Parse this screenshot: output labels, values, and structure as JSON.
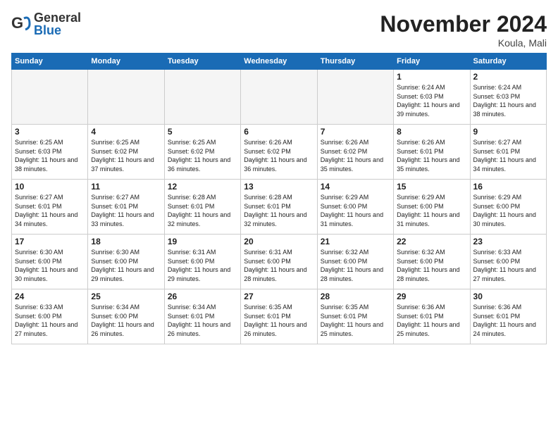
{
  "header": {
    "logo_general": "General",
    "logo_blue": "Blue",
    "month_title": "November 2024",
    "location": "Koula, Mali"
  },
  "days_of_week": [
    "Sunday",
    "Monday",
    "Tuesday",
    "Wednesday",
    "Thursday",
    "Friday",
    "Saturday"
  ],
  "weeks": [
    [
      {
        "day": "",
        "info": ""
      },
      {
        "day": "",
        "info": ""
      },
      {
        "day": "",
        "info": ""
      },
      {
        "day": "",
        "info": ""
      },
      {
        "day": "",
        "info": ""
      },
      {
        "day": "1",
        "info": "Sunrise: 6:24 AM\nSunset: 6:03 PM\nDaylight: 11 hours and 39 minutes."
      },
      {
        "day": "2",
        "info": "Sunrise: 6:24 AM\nSunset: 6:03 PM\nDaylight: 11 hours and 38 minutes."
      }
    ],
    [
      {
        "day": "3",
        "info": "Sunrise: 6:25 AM\nSunset: 6:03 PM\nDaylight: 11 hours and 38 minutes."
      },
      {
        "day": "4",
        "info": "Sunrise: 6:25 AM\nSunset: 6:02 PM\nDaylight: 11 hours and 37 minutes."
      },
      {
        "day": "5",
        "info": "Sunrise: 6:25 AM\nSunset: 6:02 PM\nDaylight: 11 hours and 36 minutes."
      },
      {
        "day": "6",
        "info": "Sunrise: 6:26 AM\nSunset: 6:02 PM\nDaylight: 11 hours and 36 minutes."
      },
      {
        "day": "7",
        "info": "Sunrise: 6:26 AM\nSunset: 6:02 PM\nDaylight: 11 hours and 35 minutes."
      },
      {
        "day": "8",
        "info": "Sunrise: 6:26 AM\nSunset: 6:01 PM\nDaylight: 11 hours and 35 minutes."
      },
      {
        "day": "9",
        "info": "Sunrise: 6:27 AM\nSunset: 6:01 PM\nDaylight: 11 hours and 34 minutes."
      }
    ],
    [
      {
        "day": "10",
        "info": "Sunrise: 6:27 AM\nSunset: 6:01 PM\nDaylight: 11 hours and 34 minutes."
      },
      {
        "day": "11",
        "info": "Sunrise: 6:27 AM\nSunset: 6:01 PM\nDaylight: 11 hours and 33 minutes."
      },
      {
        "day": "12",
        "info": "Sunrise: 6:28 AM\nSunset: 6:01 PM\nDaylight: 11 hours and 32 minutes."
      },
      {
        "day": "13",
        "info": "Sunrise: 6:28 AM\nSunset: 6:01 PM\nDaylight: 11 hours and 32 minutes."
      },
      {
        "day": "14",
        "info": "Sunrise: 6:29 AM\nSunset: 6:00 PM\nDaylight: 11 hours and 31 minutes."
      },
      {
        "day": "15",
        "info": "Sunrise: 6:29 AM\nSunset: 6:00 PM\nDaylight: 11 hours and 31 minutes."
      },
      {
        "day": "16",
        "info": "Sunrise: 6:29 AM\nSunset: 6:00 PM\nDaylight: 11 hours and 30 minutes."
      }
    ],
    [
      {
        "day": "17",
        "info": "Sunrise: 6:30 AM\nSunset: 6:00 PM\nDaylight: 11 hours and 30 minutes."
      },
      {
        "day": "18",
        "info": "Sunrise: 6:30 AM\nSunset: 6:00 PM\nDaylight: 11 hours and 29 minutes."
      },
      {
        "day": "19",
        "info": "Sunrise: 6:31 AM\nSunset: 6:00 PM\nDaylight: 11 hours and 29 minutes."
      },
      {
        "day": "20",
        "info": "Sunrise: 6:31 AM\nSunset: 6:00 PM\nDaylight: 11 hours and 28 minutes."
      },
      {
        "day": "21",
        "info": "Sunrise: 6:32 AM\nSunset: 6:00 PM\nDaylight: 11 hours and 28 minutes."
      },
      {
        "day": "22",
        "info": "Sunrise: 6:32 AM\nSunset: 6:00 PM\nDaylight: 11 hours and 28 minutes."
      },
      {
        "day": "23",
        "info": "Sunrise: 6:33 AM\nSunset: 6:00 PM\nDaylight: 11 hours and 27 minutes."
      }
    ],
    [
      {
        "day": "24",
        "info": "Sunrise: 6:33 AM\nSunset: 6:00 PM\nDaylight: 11 hours and 27 minutes."
      },
      {
        "day": "25",
        "info": "Sunrise: 6:34 AM\nSunset: 6:00 PM\nDaylight: 11 hours and 26 minutes."
      },
      {
        "day": "26",
        "info": "Sunrise: 6:34 AM\nSunset: 6:01 PM\nDaylight: 11 hours and 26 minutes."
      },
      {
        "day": "27",
        "info": "Sunrise: 6:35 AM\nSunset: 6:01 PM\nDaylight: 11 hours and 26 minutes."
      },
      {
        "day": "28",
        "info": "Sunrise: 6:35 AM\nSunset: 6:01 PM\nDaylight: 11 hours and 25 minutes."
      },
      {
        "day": "29",
        "info": "Sunrise: 6:36 AM\nSunset: 6:01 PM\nDaylight: 11 hours and 25 minutes."
      },
      {
        "day": "30",
        "info": "Sunrise: 6:36 AM\nSunset: 6:01 PM\nDaylight: 11 hours and 24 minutes."
      }
    ]
  ]
}
